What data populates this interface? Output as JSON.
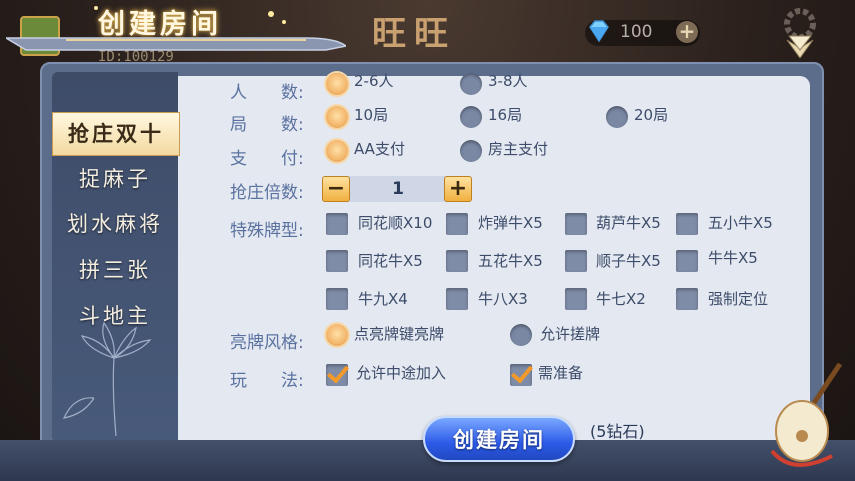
{
  "background": {
    "player_id": "ID:100129",
    "room_name": "旺旺",
    "diamonds": "100",
    "plus_symbol": "+"
  },
  "title": "创建房间",
  "games": [
    {
      "label": "抢庄双十",
      "active": true
    },
    {
      "label": "捉麻子",
      "active": false
    },
    {
      "label": "划水麻将",
      "active": false
    },
    {
      "label": "拼三张",
      "active": false
    },
    {
      "label": "斗地主",
      "active": false
    }
  ],
  "settings": {
    "players": {
      "label": "人　　数:",
      "options": [
        "2-6人",
        "3-8人"
      ],
      "selected": "2-6人"
    },
    "rounds": {
      "label": "局　　数:",
      "options": [
        "10局",
        "16局",
        "20局"
      ],
      "selected": "10局"
    },
    "payment": {
      "label": "支　　付:",
      "options": [
        "AA支付",
        "房主支付"
      ],
      "selected": "AA支付"
    },
    "multiplier": {
      "label": "抢庄倍数:",
      "value": "1",
      "minus": "−",
      "plus": "+"
    },
    "special": {
      "label": "特殊牌型:",
      "options": [
        "同花顺X10",
        "炸弹牛X5",
        "葫芦牛X5",
        "五小牛X5",
        "同花牛X5",
        "五花牛X5",
        "顺子牛X5",
        "牛牛X5",
        "牛九X4",
        "牛八X3",
        "牛七X2",
        "强制定位"
      ]
    },
    "reveal": {
      "label": "亮牌风格:",
      "options": [
        "点亮牌键亮牌",
        "允许搓牌"
      ],
      "selected": "点亮牌键亮牌"
    },
    "play": {
      "label": "玩　　法:",
      "options": [
        "允许中途加入",
        "需准备"
      ],
      "checked": [
        "允许中途加入",
        "需准备"
      ]
    }
  },
  "create_button": "创建房间",
  "cost": "(5钻石)",
  "colors": {
    "accent_orange": "#f3b66c",
    "button_blue": "#2d5be8",
    "label_blue": "#5a72a0"
  }
}
